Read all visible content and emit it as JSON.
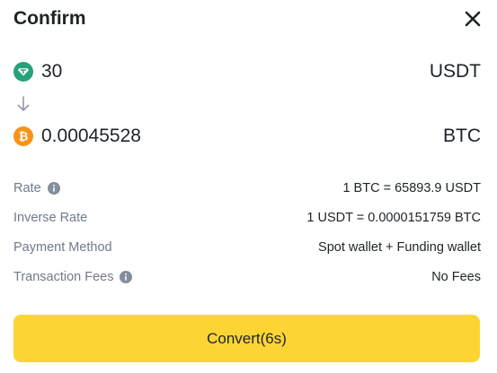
{
  "dialog": {
    "title": "Confirm",
    "close_icon": "close-icon"
  },
  "from": {
    "icon": "usdt-coin-icon",
    "icon_color": "#26a17b",
    "amount": "30",
    "currency": "USDT"
  },
  "arrow_icon": "arrow-down-icon",
  "to": {
    "icon": "btc-coin-icon",
    "icon_color": "#f7931a",
    "amount": "0.00045528",
    "currency": "BTC"
  },
  "details": [
    {
      "label": "Rate",
      "value": "1 BTC = 65893.9 USDT",
      "info": true
    },
    {
      "label": "Inverse Rate",
      "value": "1 USDT = 0.0000151759 BTC",
      "info": false
    },
    {
      "label": "Payment Method",
      "value": "Spot wallet + Funding wallet",
      "info": false
    },
    {
      "label": "Transaction Fees",
      "value": "No Fees",
      "info": true
    }
  ],
  "convert_button": {
    "label": "Convert(6s)",
    "color": "#fcd535"
  }
}
